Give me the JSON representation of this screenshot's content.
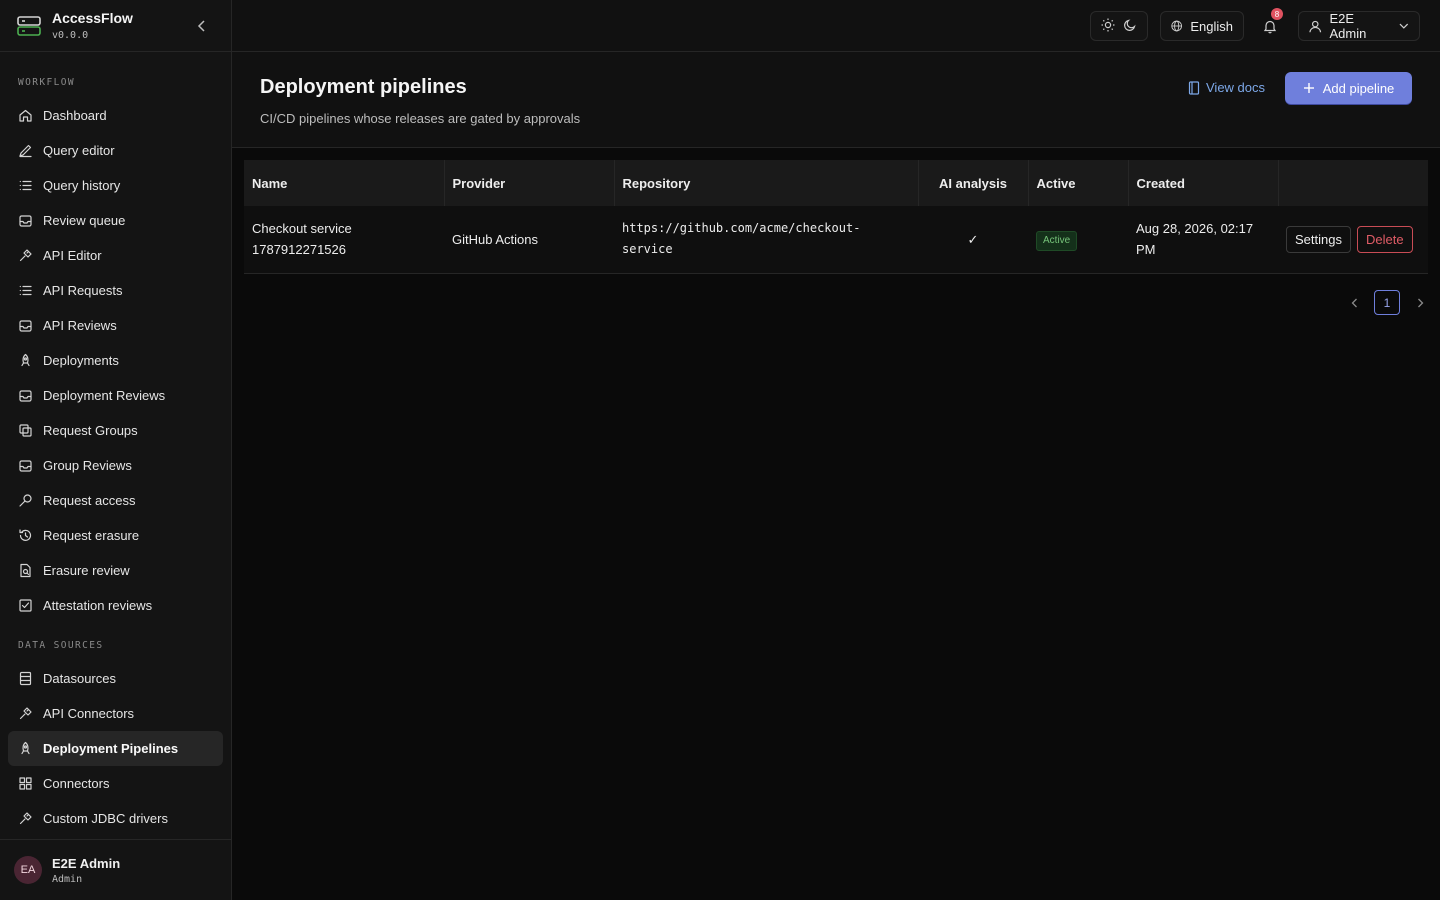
{
  "app": {
    "name": "AccessFlow",
    "version": "v0.0.0"
  },
  "sidebar": {
    "sections": [
      {
        "label": "WORKFLOW",
        "items": [
          {
            "label": "Dashboard",
            "icon": "home-icon"
          },
          {
            "label": "Query editor",
            "icon": "pencil-icon"
          },
          {
            "label": "Query history",
            "icon": "list-icon"
          },
          {
            "label": "Review queue",
            "icon": "inbox-icon"
          },
          {
            "label": "API Editor",
            "icon": "plug-icon"
          },
          {
            "label": "API Requests",
            "icon": "list-icon"
          },
          {
            "label": "API Reviews",
            "icon": "inbox-icon"
          },
          {
            "label": "Deployments",
            "icon": "rocket-icon"
          },
          {
            "label": "Deployment Reviews",
            "icon": "inbox-icon"
          },
          {
            "label": "Request Groups",
            "icon": "copy-icon"
          },
          {
            "label": "Group Reviews",
            "icon": "inbox-icon"
          },
          {
            "label": "Request access",
            "icon": "key-icon"
          },
          {
            "label": "Request erasure",
            "icon": "history-icon"
          },
          {
            "label": "Erasure review",
            "icon": "file-search-icon"
          },
          {
            "label": "Attestation reviews",
            "icon": "check-square-icon"
          }
        ]
      },
      {
        "label": "DATA SOURCES",
        "items": [
          {
            "label": "Datasources",
            "icon": "database-icon"
          },
          {
            "label": "API Connectors",
            "icon": "plug-icon"
          },
          {
            "label": "Deployment Pipelines",
            "icon": "rocket-icon",
            "active": true
          },
          {
            "label": "Connectors",
            "icon": "grid-icon"
          },
          {
            "label": "Custom JDBC drivers",
            "icon": "plug-icon"
          }
        ]
      }
    ],
    "footer": {
      "initials": "EA",
      "name": "E2E Admin",
      "role": "Admin"
    }
  },
  "topbar": {
    "language": "English",
    "notifications_count": "8",
    "user_label": "E2E Admin"
  },
  "header": {
    "title": "Deployment pipelines",
    "subtitle": "CI/CD pipelines whose releases are gated by approvals",
    "view_docs": "View docs",
    "add_button": "Add pipeline"
  },
  "table": {
    "columns": [
      "Name",
      "Provider",
      "Repository",
      "AI analysis",
      "Active",
      "Created",
      ""
    ],
    "rows": [
      {
        "name_line1": "Checkout service",
        "name_line2": "1787912271526",
        "provider": "GitHub Actions",
        "repository": "https://github.com/acme/checkout-service",
        "ai_analysis": "✓",
        "active": "Active",
        "created_line1": "Aug 28, 2026, 02:17",
        "created_line2": "PM",
        "settings": "Settings",
        "delete": "Delete"
      }
    ]
  },
  "pagination": {
    "current": "1"
  },
  "colors": {
    "accent": "#6f7fdc",
    "danger": "#e05c66",
    "success": "#76c47a",
    "link": "#7da8e8"
  }
}
